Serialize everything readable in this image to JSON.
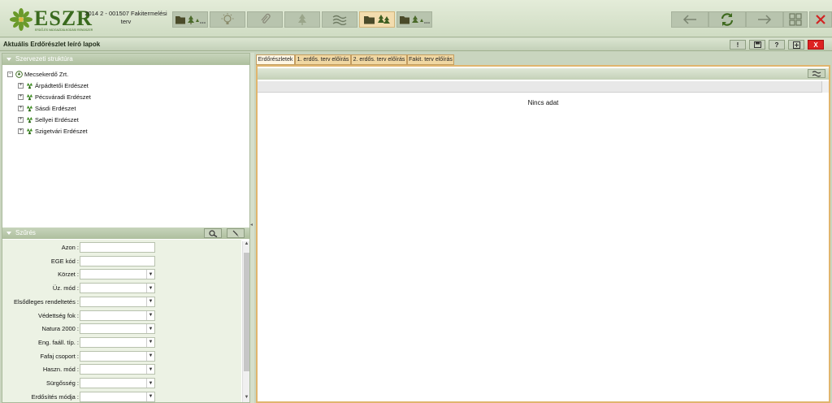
{
  "header": {
    "logo_text": "ESZR",
    "logo_subtext": "ERDŐ-ÉS VADGAZDÁLKODÁSI RENDSZER",
    "plan_title_line1": "2014 2 - 001507 Fakitermelési",
    "plan_title_line2": "terv"
  },
  "toolbar": {
    "buttons": [
      {
        "name": "folder-trees-button",
        "icon": "folder-trees-icon",
        "active": false
      },
      {
        "name": "idea-button",
        "icon": "lightbulb-icon",
        "active": false
      },
      {
        "name": "attachment-button",
        "icon": "paperclip-icon",
        "active": false
      },
      {
        "name": "tree-button",
        "icon": "tree-icon",
        "active": false
      },
      {
        "name": "waves-button",
        "icon": "waves-icon",
        "active": false
      },
      {
        "name": "folder-forest-button",
        "icon": "folder-forest-icon",
        "active": true
      },
      {
        "name": "folder-trees-alt-button",
        "icon": "folder-trees-icon",
        "active": false
      }
    ],
    "nav": {
      "back_icon": "arrow-left-icon",
      "refresh_icon": "refresh-icon",
      "forward_icon": "arrow-right-icon",
      "grid_icon": "grid-icon",
      "close_icon": "close-icon"
    }
  },
  "titlebar": {
    "title": "Aktuális Erdőrészlet leíró lapok",
    "buttons": [
      "!",
      "",
      "?",
      "",
      "X"
    ]
  },
  "org_panel": {
    "heading": "Szervezeti struktúra",
    "root": "Mecsekerdő Zrt.",
    "children": [
      "Árpádtetői Erdészet",
      "Pécsváradi Erdészet",
      "Sásdi Erdészet",
      "Sellyei Erdészet",
      "Szigetvári Erdészet"
    ]
  },
  "filter_panel": {
    "heading": "Szűrés",
    "fields": [
      {
        "label": "Azon :",
        "type": "input",
        "value": ""
      },
      {
        "label": "EGE kód :",
        "type": "input",
        "value": ""
      },
      {
        "label": "Körzet :",
        "type": "select",
        "value": ""
      },
      {
        "label": "Üz. mód :",
        "type": "select",
        "value": ""
      },
      {
        "label": "Elsődleges rendeltetés :",
        "type": "select",
        "value": ""
      },
      {
        "label": "Védettség fok :",
        "type": "select",
        "value": ""
      },
      {
        "label": "Natura 2000 :",
        "type": "select",
        "value": ""
      },
      {
        "label": "Eng. faáll. típ. :",
        "type": "select",
        "value": ""
      },
      {
        "label": "Fafaj csoport :",
        "type": "select",
        "value": ""
      },
      {
        "label": "Haszn. mód :",
        "type": "select",
        "value": ""
      },
      {
        "label": "Sürgősség :",
        "type": "select",
        "value": ""
      },
      {
        "label": "Erdősítés módja :",
        "type": "select",
        "value": ""
      }
    ]
  },
  "tabs": [
    {
      "label": "Erdőrészletek",
      "active": true
    },
    {
      "label": "1. erdős. terv előírás",
      "active": false
    },
    {
      "label": "2. erdős. terv előírás",
      "active": false
    },
    {
      "label": "Fakit. terv előírás",
      "active": false
    }
  ],
  "grid": {
    "empty_text": "Nincs adat"
  },
  "colors": {
    "accent_green": "#3a6a1e",
    "active_tab": "#fff6e3",
    "close_red": "#d22222"
  }
}
